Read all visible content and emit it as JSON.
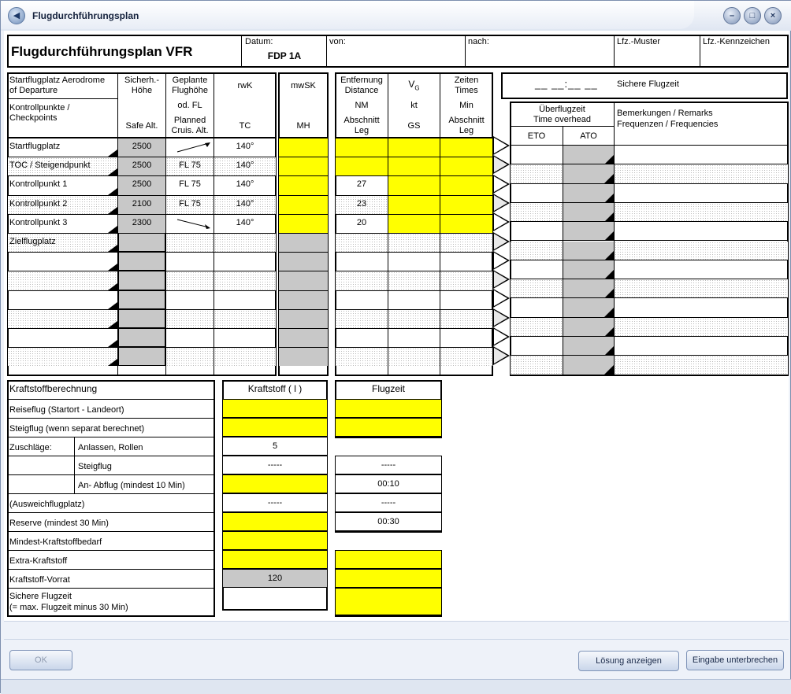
{
  "window": {
    "title": "Flugdurchführungsplan"
  },
  "header": {
    "form_title": "Flugdurchführungsplan VFR",
    "datum_label": "Datum:",
    "datum_value": "FDP 1A",
    "von_label": "von:",
    "nach_label": "nach:",
    "muster_label": "Lfz.-Muster",
    "kennzeichen_label": "Lfz.-Kennzeichen"
  },
  "plan": {
    "col1_a": "Startflugplatz  Aerodrome",
    "col1_b": "of Departure",
    "col1_c": "Kontrollpunkte /",
    "col1_d": "Checkpoints",
    "col2_a": "Sicherh.-",
    "col2_b": "Höhe",
    "col2_c": "Safe Alt.",
    "col3_a": "Geplante",
    "col3_b": "Flughöhe",
    "col3_c": "od. FL",
    "col3_d": "Planned",
    "col3_e": "Cruis. Alt.",
    "col4_a": "rwK",
    "col4_b": "TC",
    "col5_a": "mwSK",
    "col5_b": "MH",
    "col6_a": "Entfernung",
    "col6_b": "Distance",
    "col6_c": "NM",
    "col6_d": "Abschnitt",
    "col6_e": "Leg",
    "col7_a": "V",
    "col7_sub": "G",
    "col7_b": "kt",
    "col7_c": "GS",
    "col8_a": "Zeiten",
    "col8_b": "Times",
    "col8_c": "Min",
    "col8_d": "Abschnitt",
    "col8_e": "Leg",
    "safe_time_placeholder": "__ __:__ __",
    "safe_time_label": "Sichere Flugzeit",
    "overhead_a": "Überflugzeit",
    "overhead_b": "Time overhead",
    "eto": "ETO",
    "ato": "ATO",
    "remarks_a": "Bemerkungen / Remarks",
    "remarks_b": "Frequenzen / Frequencies",
    "rows": [
      {
        "name": "Startflugplatz",
        "safe": "2500",
        "alt": "",
        "tc": "140°",
        "dist": ""
      },
      {
        "name": "TOC / Steigendpunkt",
        "safe": "2500",
        "alt": "FL 75",
        "tc": "140°",
        "dist": ""
      },
      {
        "name": "Kontrollpunkt 1",
        "safe": "2500",
        "alt": "FL 75",
        "tc": "140°",
        "dist": "27"
      },
      {
        "name": "Kontrollpunkt 2",
        "safe": "2100",
        "alt": "FL 75",
        "tc": "140°",
        "dist": "23"
      },
      {
        "name": "Kontrollpunkt 3",
        "safe": "2300",
        "alt": "",
        "tc": "140°",
        "dist": "20"
      },
      {
        "name": "Zielflugplatz",
        "safe": "",
        "alt": "",
        "tc": "",
        "dist": ""
      }
    ]
  },
  "fuel": {
    "title": "Kraftstoffberechnung",
    "fuel_header": "Kraftstoff ( l )",
    "time_header": "Flugzeit",
    "reiseflug": "Reiseflug (Startort - Landeort)",
    "steigflug": "Steigflug (wenn separat berechnet)",
    "zuschlaege": "Zuschläge:",
    "anlassen": "Anlassen, Rollen",
    "steigflug2": "Steigflug",
    "anflug": "An- Abflug (mindest 10 Min)",
    "ausweich": "(Ausweichflugplatz)",
    "reserve": "Reserve (mindest 30 Min)",
    "mindest": "Mindest-Kraftstoffbedarf",
    "extra": "Extra-Kraftstoff",
    "vorrat": "Kraftstoff-Vorrat",
    "sichere_a": "Sichere Flugzeit",
    "sichere_b": "(= max. Flugzeit minus 30 Min)",
    "anlassen_fuel": "5",
    "steigflug2_fuel": "-----",
    "ausweich_fuel": "-----",
    "vorrat_fuel": "120",
    "steigflug2_time": "-----",
    "anflug_time": "00:10",
    "ausweich_time": "-----",
    "reserve_time": "00:30"
  },
  "buttons": {
    "ok": "OK",
    "solution": "Lösung anzeigen",
    "abort": "Eingabe unterbrechen"
  }
}
